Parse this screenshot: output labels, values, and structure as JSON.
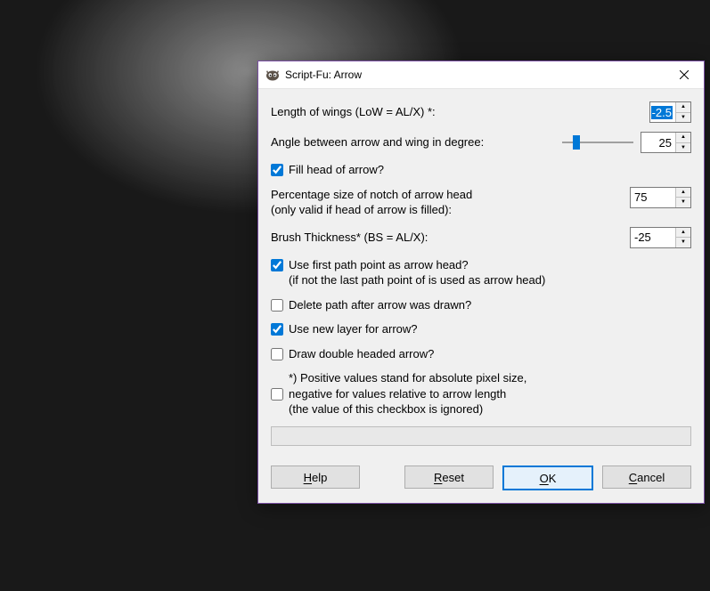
{
  "window": {
    "title": "Script-Fu: Arrow"
  },
  "fields": {
    "wings_label": "Length of wings (LoW = AL/X) *:",
    "wings_value": "-2.5",
    "angle_label": "Angle between arrow and wing in degree:",
    "angle_value": "25",
    "fill_head_label": "Fill head of arrow?",
    "fill_head_checked": true,
    "notch_label_line1": "Percentage size of notch of arrow head",
    "notch_label_line2": "(only valid if head of arrow is filled):",
    "notch_value": "75",
    "brush_label": "Brush Thickness* (BS = AL/X):",
    "brush_value": "-25",
    "first_point_line1": "Use first path point as arrow head?",
    "first_point_line2": "(if not the last path point of is used as arrow head)",
    "first_point_checked": true,
    "delete_path_label": "Delete path after arrow was drawn?",
    "delete_path_checked": false,
    "new_layer_label": "Use new layer for arrow?",
    "new_layer_checked": true,
    "double_headed_label": "Draw double headed arrow?",
    "double_headed_checked": false,
    "footnote_line1": "*) Positive values stand for absolute pixel size,",
    "footnote_line2": "negative for values relative to arrow length",
    "footnote_line3": "(the value of this checkbox is ignored)",
    "footnote_checked": false
  },
  "buttons": {
    "help": "Help",
    "reset": "Reset",
    "ok": "OK",
    "cancel": "Cancel"
  }
}
